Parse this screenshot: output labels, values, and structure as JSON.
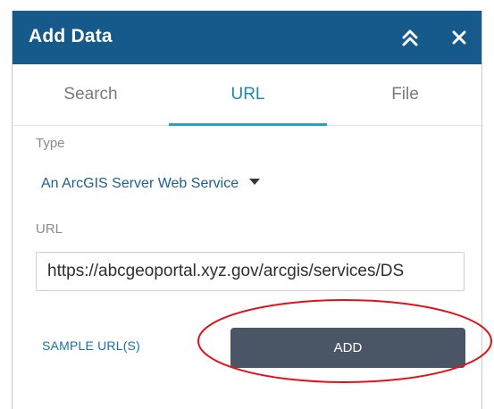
{
  "dialog": {
    "title": "Add Data",
    "header_color": "#155a8a"
  },
  "tabs": [
    {
      "label": "Search",
      "active": false
    },
    {
      "label": "URL",
      "active": true
    },
    {
      "label": "File",
      "active": false
    }
  ],
  "form": {
    "type_label": "Type",
    "type_value": "An ArcGIS Server Web Service",
    "url_label": "URL",
    "url_value": "https://abcgeoportal.xyz.gov/arcgis/services/DS",
    "sample_link": "SAMPLE URL(S)",
    "add_button": "ADD"
  },
  "colors": {
    "accent": "#2aa0c2",
    "link": "#1b6fa8",
    "button": "#4a5566",
    "annotation": "#e0131a"
  },
  "icons": {
    "collapse": "double-chevron-up-icon",
    "close": "close-icon",
    "dropdown": "caret-down-icon"
  }
}
